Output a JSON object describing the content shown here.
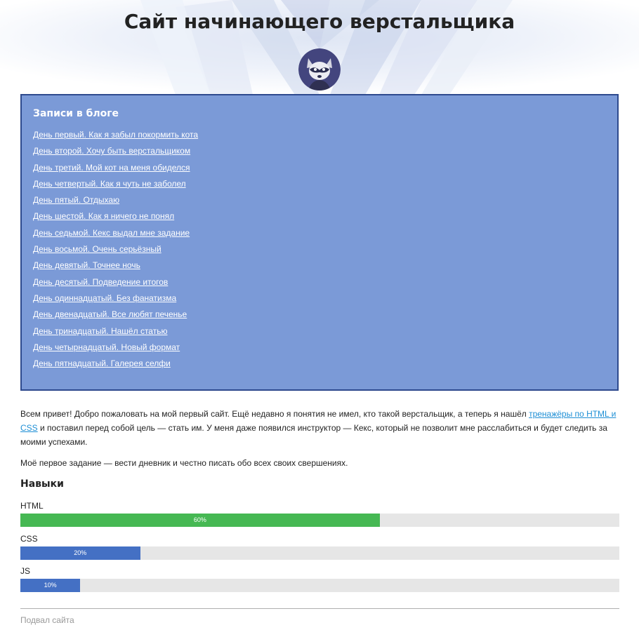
{
  "header": {
    "title": "Сайт начинающего верстальщика"
  },
  "blog": {
    "title": "Записи в блоге",
    "posts": [
      "День первый. Как я забыл покормить кота",
      "День второй. Хочу быть верстальщиком",
      "День третий. Мой кот на меня обиделся",
      "День четвертый. Как я чуть не заболел",
      "День пятый. Отдыхаю",
      "День шестой. Как я ничего не понял",
      "День седьмой. Кекс выдал мне задание",
      "День восьмой. Очень серьёзный",
      "День девятый. Точнее ночь",
      "День десятый. Подведение итогов",
      "День одиннадцатый. Без фанатизма",
      "День двенадцатый. Все любят печенье",
      "День тринадцатый. Нашёл статью",
      "День четырнадцатый. Новый формат",
      "День пятнадцатый. Галерея селфи"
    ]
  },
  "intro": {
    "before_link": "Всем привет! Добро пожаловать на мой первый сайт. Ещё недавно я понятия не имел, кто такой верстальщик, а теперь я нашёл ",
    "link_text": "тренажёры по HTML и CSS",
    "after_link": " и поставил перед собой цель — стать им. У меня даже появился инструктор — Кекс, который не позволит мне расслабиться и будет следить за моими успехами."
  },
  "task": "Моё первое задание — вести дневник и честно писать обо всех своих свершениях.",
  "skills": {
    "title": "Навыки",
    "items": [
      {
        "name": "HTML",
        "value": 60,
        "label": "60%",
        "color": "#46b853"
      },
      {
        "name": "CSS",
        "value": 20,
        "label": "20%",
        "color": "#4470c4"
      },
      {
        "name": "JS",
        "value": 10,
        "label": "10%",
        "color": "#4470c4"
      }
    ]
  },
  "colors": {
    "blog_bg": "#7b9ad7",
    "blog_border": "#2e4a8e",
    "link": "#1e8fd5",
    "bar_track": "#e6e6e6"
  },
  "footer": {
    "text": "Подвал сайта"
  }
}
